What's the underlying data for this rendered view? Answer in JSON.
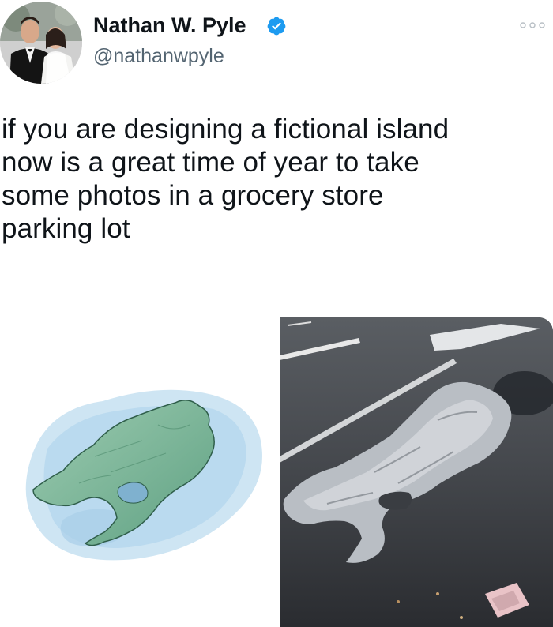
{
  "author": {
    "display_name": "Nathan W. Pyle",
    "handle": "@nathanwpyle",
    "verified": true,
    "verified_color": "#1d9bf0"
  },
  "tweet": {
    "text_lines": [
      "if you are designing a fictional island",
      "now is a great time of year to take",
      "some photos in a grocery store",
      "parking lot"
    ]
  },
  "icons": {
    "more": "more-horizontal-icon",
    "verified": "verified-badge-icon"
  },
  "colors": {
    "text": "#0f1419",
    "secondary_text": "#536471",
    "island_green": "#7fb89a",
    "water_blue": "#b9d8ee",
    "asphalt": "#3b3e43"
  }
}
